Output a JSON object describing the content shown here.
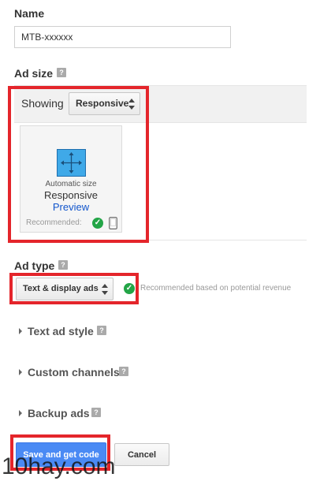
{
  "name_section": {
    "label": "Name",
    "value": "MTB-xxxxxx"
  },
  "ad_size": {
    "label": "Ad size",
    "help": "?",
    "showing_label": "Showing",
    "showing_value": "Responsive",
    "card": {
      "line1": "Automatic size",
      "line2": "Responsive",
      "preview": "Preview",
      "recommended": "Recommended:"
    }
  },
  "ad_type": {
    "label": "Ad type",
    "help": "?",
    "select_value": "Text & display ads",
    "recommendation": "Recommended based on potential revenue"
  },
  "expanders": [
    {
      "label": "Text ad style",
      "help": "?"
    },
    {
      "label": "Custom channels",
      "help": "?"
    },
    {
      "label": "Backup ads",
      "help": "?"
    }
  ],
  "buttons": {
    "save": "Save and get code",
    "cancel": "Cancel"
  },
  "watermark": "10hay.com",
  "colors": {
    "highlight": "#e4252b",
    "primary": "#4a8af4",
    "success": "#23a547",
    "link": "#1155cc"
  }
}
